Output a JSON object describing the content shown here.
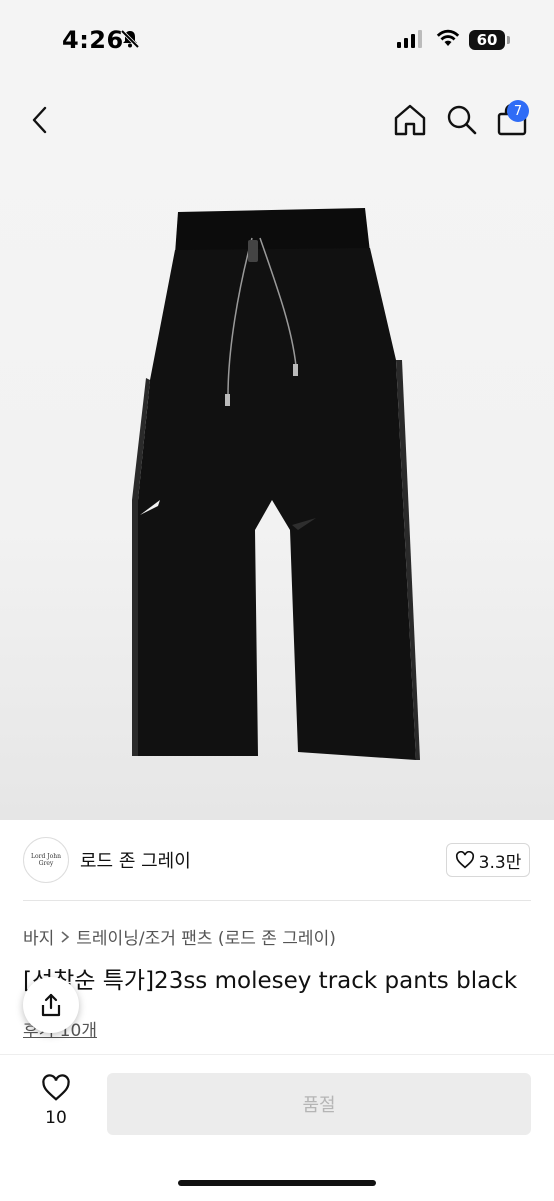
{
  "status": {
    "time": "4:26",
    "battery": "60"
  },
  "nav": {
    "cart_count": "7"
  },
  "brand": {
    "logo_text": "Lord John Grey",
    "name": "로드 존 그레이",
    "likes": "3.3만"
  },
  "breadcrumb": {
    "category": "바지",
    "subcategory": "트레이닝/조거 팬츠 (로드 존 그레이)"
  },
  "product": {
    "title": "[선착순 특가]23ss molesey track pants black",
    "review_text": "후기 10개"
  },
  "bottom": {
    "wish_count": "10",
    "buy_label": "품절"
  },
  "colors": {
    "accent": "#2f6cf6",
    "soldout_bg": "#ececec",
    "soldout_text": "#b5b5b5"
  }
}
